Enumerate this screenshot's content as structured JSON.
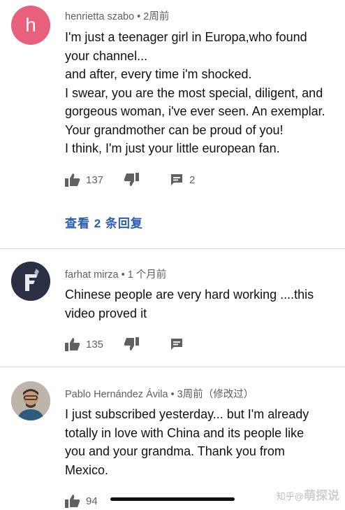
{
  "comments": [
    {
      "avatar_letter": "h",
      "author": "henrietta szabo",
      "time": "2周前",
      "lines": [
        "I'm just a teenager girl in Europa,who found",
        "your channel...",
        "and after, every time i'm shocked.",
        "I swear, you are the most special, diligent, and",
        "gorgeous woman, i've ever seen. An exemplar.",
        "Your grandmother can be proud of you!",
        "I think, I'm just your little european fan."
      ],
      "likes": "137",
      "replies_count": "2",
      "view_replies": "查看 2 条回复"
    },
    {
      "avatar_letter": "F",
      "author": "farhat mirza",
      "time": "1 个月前",
      "lines": [
        "Chinese people are very hard working ....this",
        "video proved it"
      ],
      "likes": "135"
    },
    {
      "author": "Pablo Hernández Ávila",
      "time": "3周前（修改过）",
      "lines": [
        "I just subscribed yesterday... but I'm already",
        "totally in love with China and its people like",
        "you and your grandma. Thank you from",
        "Mexico."
      ],
      "likes": "94"
    }
  ],
  "meta_separator": " • ",
  "watermark": {
    "sub": "知乎@",
    "main": "萌探说"
  },
  "colors": {
    "avatar_h": "#e8607c",
    "link_blue": "#2a5db0",
    "meta_gray": "#606060"
  },
  "icons": [
    "thumbs-up-icon",
    "thumbs-down-icon",
    "reply-icon"
  ]
}
